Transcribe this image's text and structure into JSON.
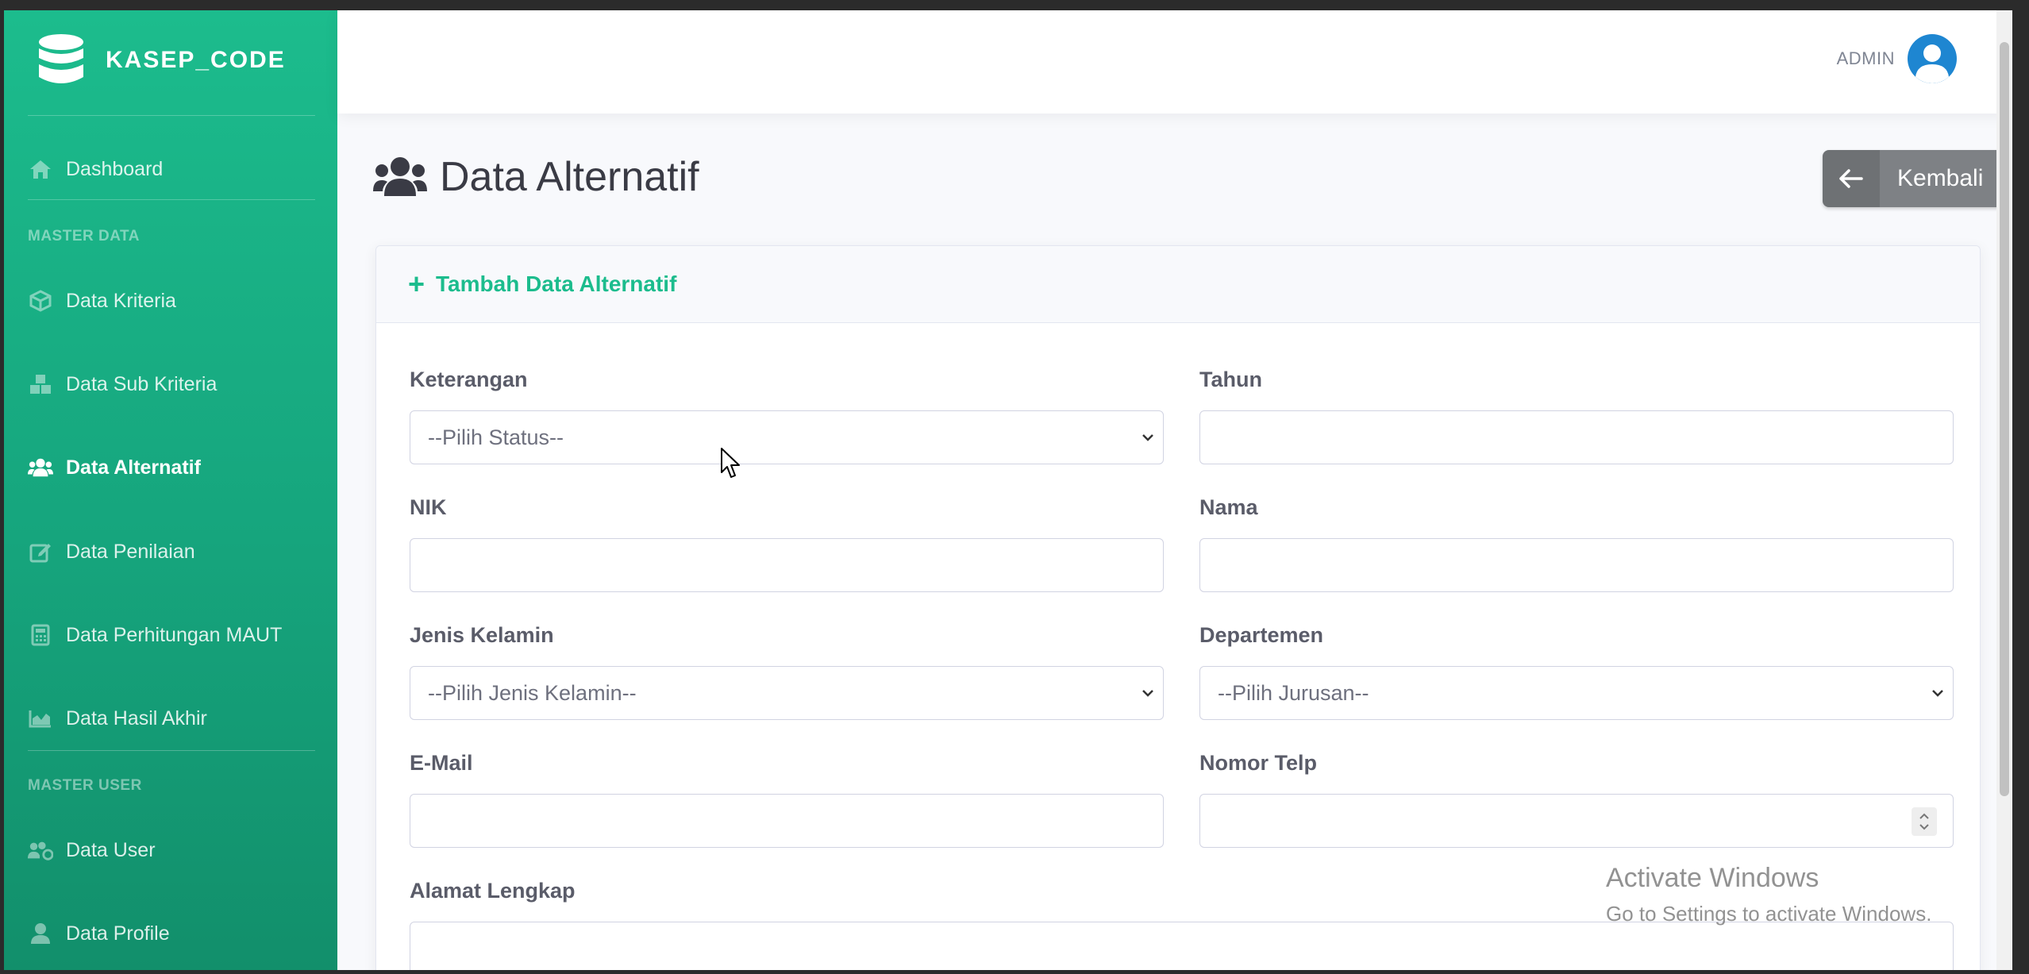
{
  "brand": {
    "name": "KASEP_CODE",
    "icon": "database-icon"
  },
  "sidebar": {
    "dashboard": {
      "label": "Dashboard",
      "icon": "home-icon"
    },
    "section_master_data": "MASTER DATA",
    "items": [
      {
        "label": "Data Kriteria",
        "icon": "cube-icon"
      },
      {
        "label": "Data Sub Kriteria",
        "icon": "cubes-icon"
      },
      {
        "label": "Data Alternatif",
        "icon": "users-icon",
        "active": true
      },
      {
        "label": "Data Penilaian",
        "icon": "edit-icon"
      },
      {
        "label": "Data Perhitungan MAUT",
        "icon": "calculator-icon"
      },
      {
        "label": "Data Hasil Akhir",
        "icon": "chart-area-icon"
      }
    ],
    "section_master_user": "MASTER USER",
    "user_items": [
      {
        "label": "Data User",
        "icon": "users-cog-icon"
      },
      {
        "label": "Data Profile",
        "icon": "user-icon"
      }
    ]
  },
  "topbar": {
    "user_name": "ADMIN",
    "avatar_icon": "user-circle-icon"
  },
  "page": {
    "title": "Data Alternatif",
    "title_icon": "users-icon",
    "back_label": "Kembali"
  },
  "card": {
    "header": "Tambah Data Alternatif",
    "fields": {
      "keterangan": {
        "label": "Keterangan",
        "value": "--Pilih Status--"
      },
      "tahun": {
        "label": "Tahun",
        "value": ""
      },
      "nik": {
        "label": "NIK",
        "value": ""
      },
      "nama": {
        "label": "Nama",
        "value": ""
      },
      "jenis_kelamin": {
        "label": "Jenis Kelamin",
        "value": "--Pilih Jenis Kelamin--"
      },
      "departemen": {
        "label": "Departemen",
        "value": "--Pilih Jurusan--"
      },
      "email": {
        "label": "E-Mail",
        "value": ""
      },
      "nomor_telp": {
        "label": "Nomor Telp",
        "value": ""
      },
      "alamat": {
        "label": "Alamat Lengkap",
        "value": ""
      }
    }
  },
  "watermark": {
    "line1": "Activate Windows",
    "line2": "Go to Settings to activate Windows."
  },
  "colors": {
    "primary": "#1cbc8d",
    "primary_dark": "#128f6b",
    "back_button": "#7e8185",
    "avatar": "#1e86d1"
  }
}
